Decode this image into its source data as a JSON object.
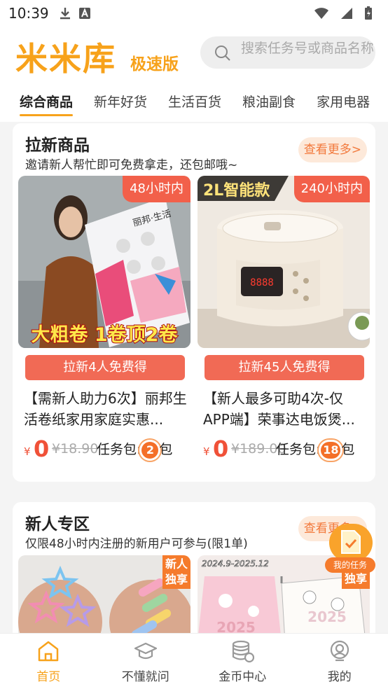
{
  "status_bar": {
    "time": "10:39"
  },
  "header": {
    "logo": "米米库",
    "logo_sub": "极速版",
    "search_placeholder": "搜索任务号或商品名称"
  },
  "tabs": [
    "综合商品",
    "新年好货",
    "生活百货",
    "粮油副食",
    "家用电器"
  ],
  "section_new": {
    "title": "拉新商品",
    "subtitle": "邀请新人帮忙即可免费拿走，还包邮哦~",
    "more": "查看更多>",
    "cards": [
      {
        "time_tag": "48小时内",
        "image_caption": "大粗卷 1卷顶2卷",
        "package_brand": "丽邦·生活",
        "button": "拉新4人免费得",
        "title": "【需新人助力6次】丽邦生活卷纸家用家庭实惠...",
        "currency": "¥",
        "price": "0",
        "orig_price": "¥18.90",
        "pkg_label": "任务包:",
        "pkg_num": "2",
        "pkg_unit": "包"
      },
      {
        "time_tag": "240小时内",
        "image_caption": "2L智能款",
        "button": "拉新45人免费得",
        "title": "【新人最多可助4次-仅APP端】荣事达电饭煲...",
        "currency": "¥",
        "price": "0",
        "orig_price": "¥189.00",
        "pkg_label": "任务包:",
        "pkg_num": "18",
        "pkg_unit": "包"
      }
    ]
  },
  "section_newbie": {
    "title": "新人专区",
    "subtitle": "仅限48小时内注册的新用户可参与(限1单)",
    "more": "查看更多>",
    "cards": [
      {
        "badge": "新人独享"
      },
      {
        "badge": "独享",
        "image_caption": "2024.9-2025.12",
        "year": "2025"
      }
    ]
  },
  "float_button": {
    "label": "我的任务"
  },
  "bottom_nav": [
    {
      "label": "首页",
      "icon": "home-icon"
    },
    {
      "label": "不懂就问",
      "icon": "graduation-cap-icon"
    },
    {
      "label": "金币中心",
      "icon": "coin-stack-icon"
    },
    {
      "label": "我的",
      "icon": "user-icon"
    }
  ],
  "colors": {
    "accent": "#f7a21b",
    "red": "#f05138",
    "button": "#f16a55"
  }
}
